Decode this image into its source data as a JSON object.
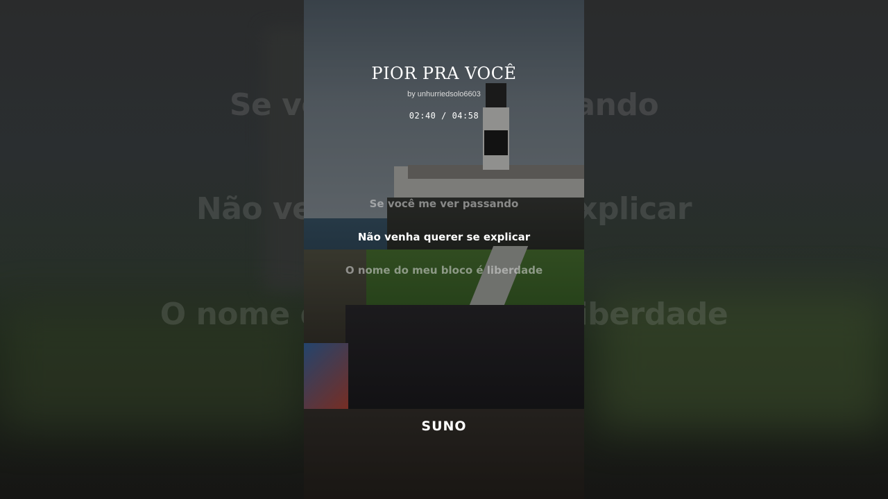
{
  "song": {
    "title": "PIOR PRA VOCÊ",
    "byline": "by unhurriedsolo6603",
    "time": "02:40 / 04:58"
  },
  "lyrics": {
    "previous": "Se você me ver passando",
    "current": "Não venha querer se explicar",
    "next": "O nome do meu bloco é liberdade"
  },
  "background_lyrics": {
    "line1": "Se você me ver passando",
    "line2": "Não venha querer se explicar",
    "line3": "O nome do meu bloco é liberdade"
  },
  "brand": {
    "logo_text": "SUNO"
  }
}
